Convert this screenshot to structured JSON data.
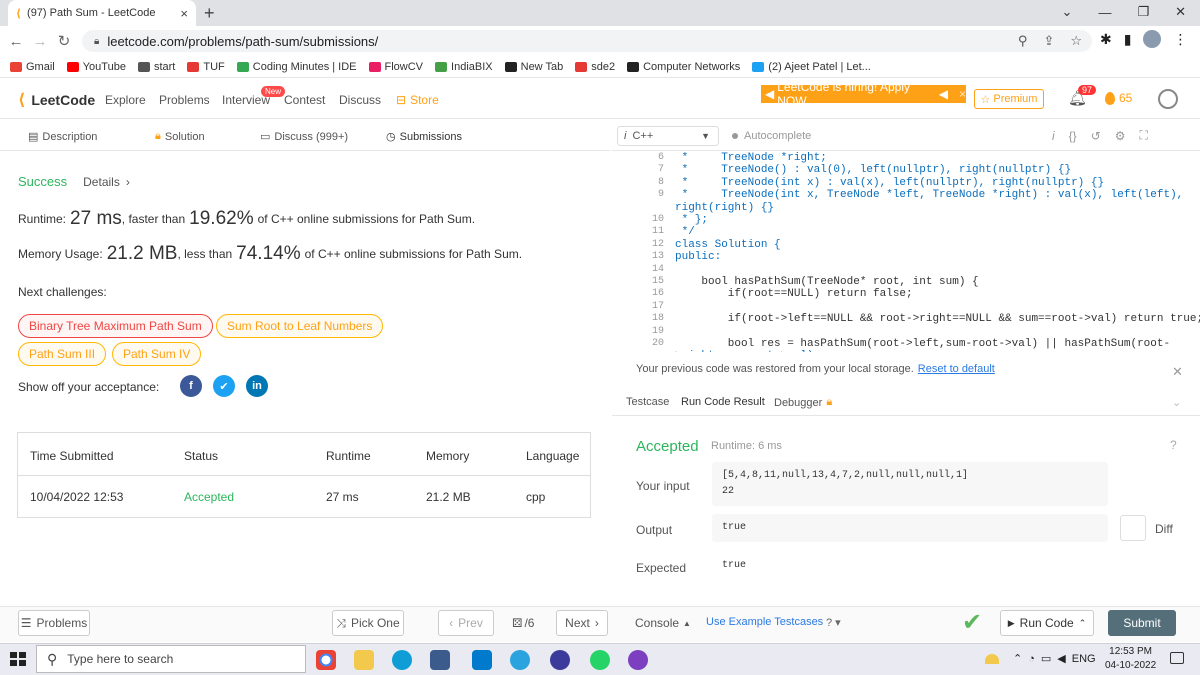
{
  "browser": {
    "tab_title": "(97) Path Sum - LeetCode",
    "url": "leetcode.com/problems/path-sum/submissions/",
    "bookmarks": [
      "Gmail",
      "YouTube",
      "start",
      "TUF",
      "Coding Minutes | IDE",
      "FlowCV",
      "IndiaBIX",
      "New Tab",
      "sde2",
      "Computer Networks",
      "(2) Ajeet Patel | Let..."
    ],
    "bookmark_colors": [
      "#ea4335",
      "#ff0000",
      "#555555",
      "#e53935",
      "#34a853",
      "#e91e63",
      "#43a047",
      "#222222",
      "#e53935",
      "#222222",
      "#1da1f2"
    ]
  },
  "header": {
    "logo": "LeetCode",
    "nav": [
      "Explore",
      "Problems",
      "Interview",
      "Contest",
      "Discuss",
      "Store"
    ],
    "new_badge": "New",
    "hiring": "LeetCode is hiring! Apply NOW.",
    "premium": "Premium",
    "notifications": "97",
    "streak": "65"
  },
  "left_tabs": [
    "Description",
    "Solution",
    "Discuss (999+)",
    "Submissions"
  ],
  "result": {
    "status": "Success",
    "details": "Details",
    "runtime_label": "Runtime:",
    "runtime_value": "27 ms",
    "runtime_mid": ", faster than",
    "runtime_pct": "19.62%",
    "runtime_tail": "of C++ online submissions for Path Sum.",
    "memory_label": "Memory Usage:",
    "memory_value": "21.2 MB",
    "memory_mid": ", less than",
    "memory_pct": "74.14%",
    "memory_tail": "of C++ online submissions for Path Sum.",
    "next_challenges": "Next challenges:",
    "challenges": [
      "Binary Tree Maximum Path Sum",
      "Sum Root to Leaf Numbers",
      "Path Sum III",
      "Path Sum IV"
    ],
    "challenge_colors": [
      "#ef4743",
      "#ffa116",
      "#ffa116",
      "#ffa116"
    ],
    "show_off": "Show off your acceptance:"
  },
  "submissions_table": {
    "headers": [
      "Time Submitted",
      "Status",
      "Runtime",
      "Memory",
      "Language"
    ],
    "rows": [
      [
        "10/04/2022 12:53",
        "Accepted",
        "27 ms",
        "21.2 MB",
        "cpp"
      ]
    ]
  },
  "bottom": {
    "problems": "Problems",
    "pick_one": "Pick One",
    "prev": "Prev",
    "page": "/6",
    "next": "Next",
    "console": "Console",
    "use_example": "Use Example Testcases",
    "run_code": "Run Code",
    "submit": "Submit"
  },
  "editor": {
    "language": "C++",
    "autocomplete": "Autocomplete",
    "lines": [
      {
        "n": "6",
        "t": " *     TreeNode *right;"
      },
      {
        "n": "7",
        "t": " *     TreeNode() : val(0), left(nullptr), right(nullptr) {}"
      },
      {
        "n": "8",
        "t": " *     TreeNode(int x) : val(x), left(nullptr), right(nullptr) {}"
      },
      {
        "n": "9",
        "t": " *     TreeNode(int x, TreeNode *left, TreeNode *right) : val(x), left(left),"
      },
      {
        "n": "",
        "t": "right(right) {}"
      },
      {
        "n": "10",
        "t": " * };"
      },
      {
        "n": "11",
        "t": " */"
      },
      {
        "n": "12",
        "t": "class Solution {"
      },
      {
        "n": "13",
        "t": "public:"
      },
      {
        "n": "14",
        "t": ""
      },
      {
        "n": "15",
        "t": "    bool hasPathSum(TreeNode* root, int sum) {"
      },
      {
        "n": "16",
        "t": "        if(root==NULL) return false;"
      },
      {
        "n": "17",
        "t": ""
      },
      {
        "n": "18",
        "t": "        if(root->left==NULL && root->right==NULL && sum==root->val) return true;"
      },
      {
        "n": "19",
        "t": ""
      },
      {
        "n": "20",
        "t": "        bool res = hasPathSum(root->left,sum-root->val) || hasPathSum(root-"
      },
      {
        "n": "",
        "t": ">right,sum-root->val);"
      }
    ],
    "restored": "Your previous code was restored from your local storage.",
    "reset": "Reset to default"
  },
  "run_result": {
    "tabs": [
      "Testcase",
      "Run Code Result",
      "Debugger"
    ],
    "status": "Accepted",
    "runtime": "Runtime: 6 ms",
    "input_label": "Your input",
    "input_line1": "[5,4,8,11,null,13,4,7,2,null,null,null,1]",
    "input_line2": "22",
    "output_label": "Output",
    "output": "true",
    "expected_label": "Expected",
    "expected": "true",
    "diff": "Diff"
  },
  "taskbar": {
    "search": "Type here to search",
    "lang": "ENG",
    "time": "12:53 PM",
    "date": "04-10-2022"
  }
}
